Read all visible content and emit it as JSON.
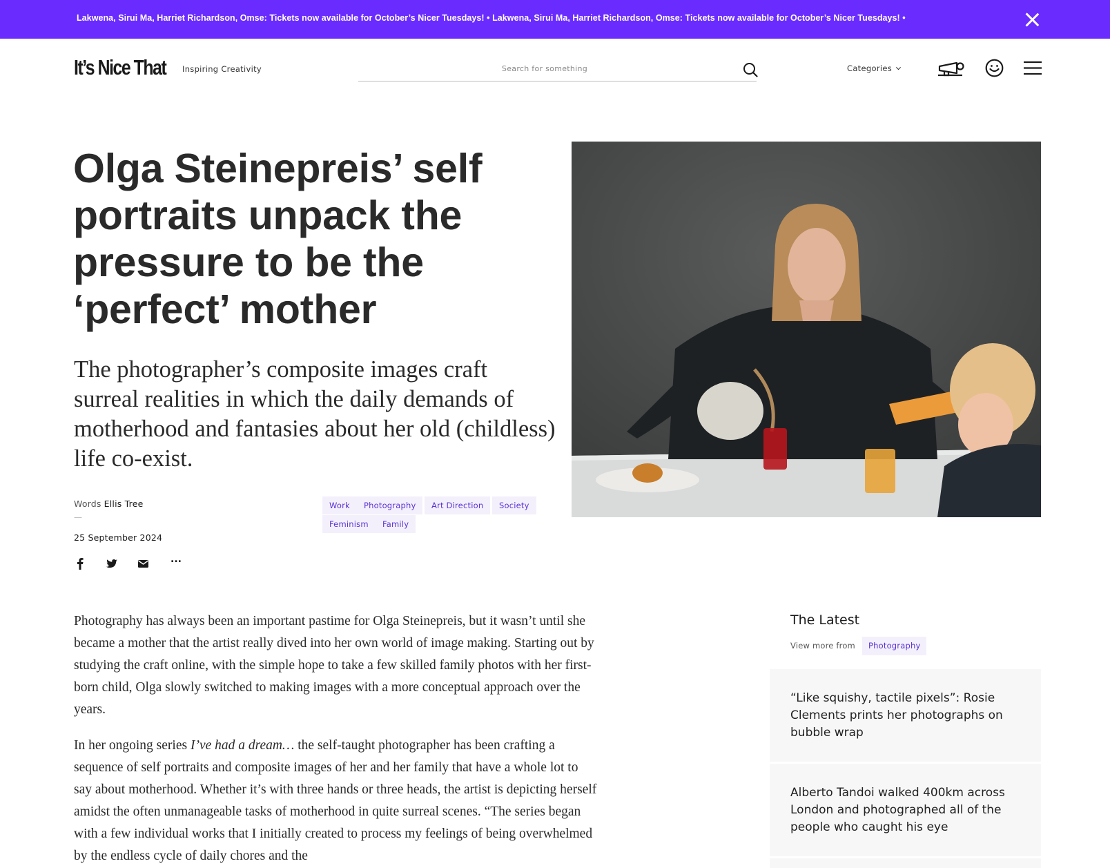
{
  "banner": {
    "text": "Lakwena, Sirui Ma, Harriet Richardson, Omse: Tickets now available for October’s Nicer Tuesdays! • Lakwena, Sirui Ma, Harriet Richardson, Omse: Tickets now available for October’s Nicer Tuesdays!   •",
    "close_icon": "close-icon"
  },
  "header": {
    "logo": "It’s Nice That",
    "tagline": "Inspiring Creativity",
    "search_placeholder": "Search for something",
    "categories_label": "Categories",
    "icons": [
      "search-icon",
      "chevron-down-icon",
      "megaphone-icon",
      "smiley-icon",
      "menu-icon"
    ]
  },
  "article": {
    "headline": "Olga Steinepreis’ self portraits unpack the pressure to be the ‘perfect’ mother",
    "standfirst": "The photographer’s composite images craft surreal realities in which the daily demands of motherhood and fantasies about her old (childless) life co-exist.",
    "words_label": "Words",
    "author": "Ellis Tree",
    "dash": "—",
    "date": "25 September 2024",
    "tags": [
      "Work",
      "Photography",
      "Art Direction",
      "Society",
      "Feminism",
      "Family"
    ],
    "share_icons": [
      "facebook-icon",
      "twitter-icon",
      "email-icon",
      "more-icon"
    ],
    "share_more": "...",
    "para1": "Photography has always been an important pastime for Olga Steinepreis, but it wasn’t until she became a mother that the artist really dived into her own world of image making. Starting out by studying the craft online, with the simple hope to take a few skilled family photos with her first-born child, Olga slowly switched to making images with a more conceptual approach over the years.",
    "para2_before": "In her ongoing series ",
    "para2_italic": "I’ve had a dream…",
    "para2_after": " the self-taught photographer has been crafting a sequence of self portraits and composite images of her and her family that have a whole lot to say about motherhood. Whether it’s with three hands or three heads, the artist is depicting herself amidst the often unmanageable tasks of motherhood in quite surreal scenes. “The series began with a few individual works that I initially created to process my feelings of being overwhelmed by the endless cycle of daily chores and the"
  },
  "latest": {
    "title": "The Latest",
    "view_more": "View more from",
    "view_more_tag": "Photography",
    "items": [
      "“Like squishy, tactile pixels”: Rosie Clements prints her photographs on bubble wrap",
      "Alberto Tandoi walked 400km across London and photographed all of the people who caught his eye"
    ]
  },
  "colors": {
    "banner": "#6a2bff",
    "tag_bg": "#f3f0fb",
    "tag_text": "#5b32d6",
    "card_bg": "#f7f7f7"
  }
}
